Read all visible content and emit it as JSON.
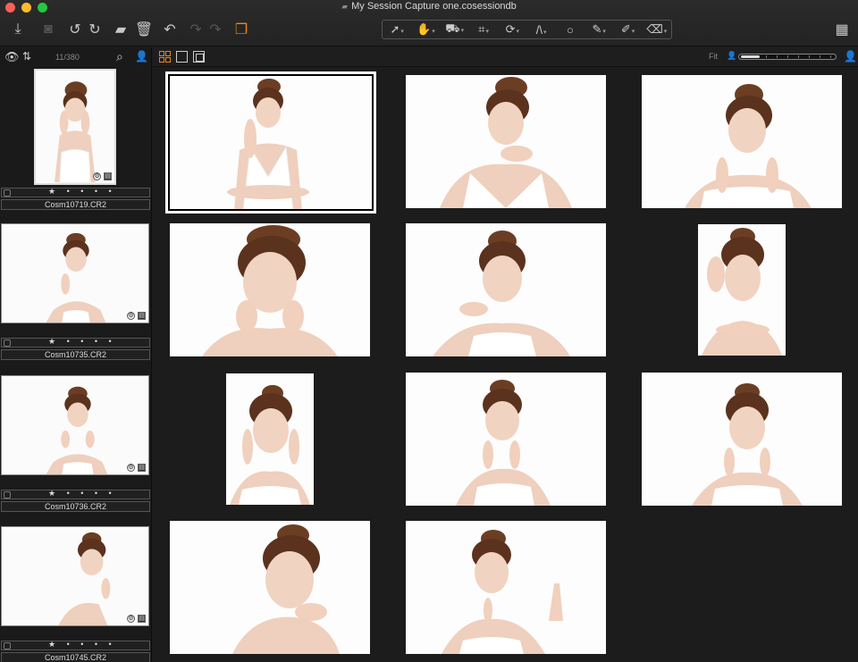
{
  "window": {
    "title": "My Session Capture one.cosessiondb"
  },
  "toolbar": {
    "left_icons": [
      "import-icon",
      "camera-icon",
      "rotate-left-icon",
      "rotate-right-icon",
      "folder-move-icon",
      "trash-icon",
      "undo-icon",
      "redo-icon",
      "redo-icon",
      "stack-icon"
    ],
    "tools": [
      "select-tool",
      "hand-tool",
      "keystone-tool",
      "crop-tool",
      "rotate-tool",
      "straighten-tool",
      "spot-tool",
      "brush-tool",
      "picker-tool",
      "erase-tool"
    ],
    "accent": "#e8871e"
  },
  "sidebar": {
    "counter": "11/380",
    "items": [
      {
        "stars": "★ • • • •",
        "filename": "Cosm10719.CR2"
      },
      {
        "stars": "★ • • • •",
        "filename": "Cosm10735.CR2"
      },
      {
        "stars": "★ • • • •",
        "filename": "Cosm10736.CR2"
      },
      {
        "stars": "★ • • • •",
        "filename": "Cosm10745.CR2"
      }
    ]
  },
  "viewer": {
    "zoom_label": "Fit",
    "zoom_level": 0.2,
    "photo_count": 11,
    "selected_index": 0
  }
}
